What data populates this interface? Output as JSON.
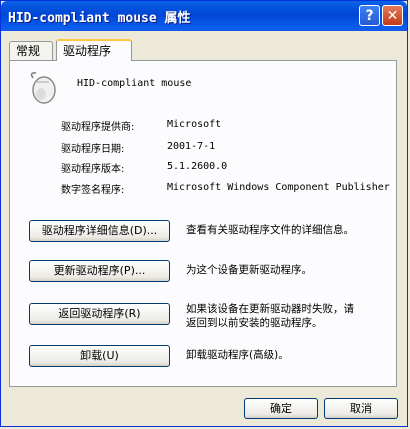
{
  "window": {
    "title": "HID-compliant mouse 属性",
    "help_label": "?",
    "close_label": "✕"
  },
  "tabs": [
    {
      "label": "常规"
    },
    {
      "label": "驱动程序"
    }
  ],
  "device": {
    "name": "HID-compliant mouse",
    "icon": "mouse-icon"
  },
  "properties": [
    {
      "label": "驱动程序提供商:",
      "value": "Microsoft"
    },
    {
      "label": "驱动程序日期:",
      "value": "2001-7-1"
    },
    {
      "label": "驱动程序版本:",
      "value": "5.1.2600.0"
    },
    {
      "label": "数字签名程序:",
      "value": "Microsoft Windows Component Publisher"
    }
  ],
  "actions": [
    {
      "button": "驱动程序详细信息(D)...",
      "description": "查看有关驱动程序文件的详细信息。"
    },
    {
      "button": "更新驱动程序(P)...",
      "description": "为这个设备更新驱动程序。"
    },
    {
      "button": "返回驱动程序(R)",
      "description_line1": "如果该设备在更新驱动器时失败，请",
      "description_line2": "返回到以前安装的驱动程序。"
    },
    {
      "button": "卸载(U)",
      "description": "卸载驱动程序(高级)。"
    }
  ],
  "footer": {
    "ok_label": "确定",
    "cancel_label": "取消"
  },
  "colors": {
    "titlebar": "#0046d5",
    "tab_highlight": "#ffc83c",
    "close_button": "#c33a16"
  }
}
